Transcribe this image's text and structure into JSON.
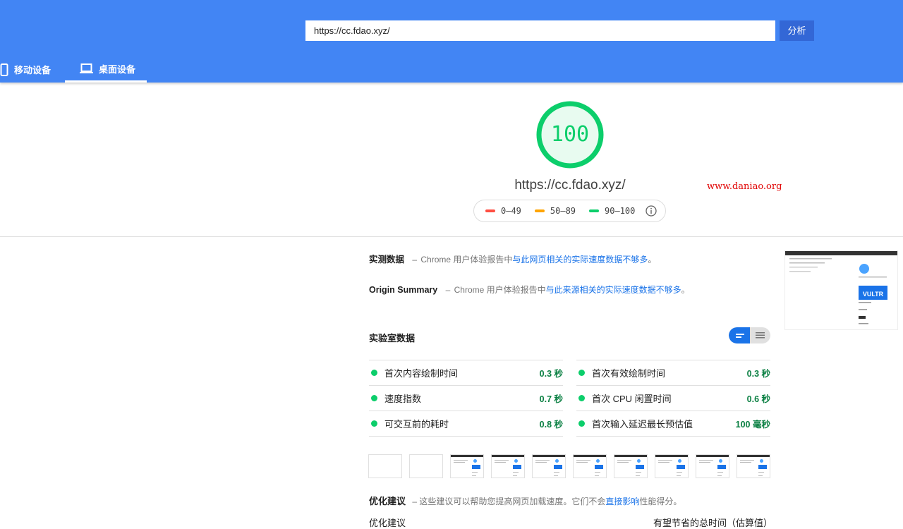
{
  "header": {
    "url_value": "https://cc.fdao.xyz/",
    "analyze_label": "分析",
    "tabs": [
      {
        "label": "移动设备",
        "icon": "phone-icon",
        "active": false
      },
      {
        "label": "桌面设备",
        "icon": "laptop-icon",
        "active": true
      }
    ]
  },
  "summary": {
    "score": "100",
    "score_fraction": 1.0,
    "url": "https://cc.fdao.xyz/",
    "watermark": "www.daniao.org",
    "legend": [
      {
        "range": "0–49",
        "color": "#ff4e42"
      },
      {
        "range": "50–89",
        "color": "#ffa400"
      },
      {
        "range": "90–100",
        "color": "#0cce6b"
      }
    ]
  },
  "field_data": {
    "title": "实测数据",
    "dash": "–",
    "prefix": "Chrome 用户体验报告中",
    "link": "与此网页相关的实际速度数据不够多",
    "suffix": "。"
  },
  "origin_summary": {
    "title": "Origin Summary",
    "dash": "–",
    "prefix": "Chrome 用户体验报告中",
    "link": "与此来源相关的实际速度数据不够多",
    "suffix": "。"
  },
  "lab_data": {
    "title": "实验室数据",
    "metrics": [
      {
        "label": "首次内容绘制时间",
        "value": "0.3 秒"
      },
      {
        "label": "首次有效绘制时间",
        "value": "0.3 秒"
      },
      {
        "label": "速度指数",
        "value": "0.7 秒"
      },
      {
        "label": "首次 CPU 闲置时间",
        "value": "0.6 秒"
      },
      {
        "label": "可交互前的耗时",
        "value": "0.8 秒"
      },
      {
        "label": "首次输入延迟最长预估值",
        "value": "100 毫秒"
      }
    ]
  },
  "thumbnail": {
    "brand_text": "VULTR"
  },
  "opportunities": {
    "title": "优化建议",
    "dash": "–",
    "prefix": "这些建议可以帮助您提高网页加载速度。它们不会",
    "link": "直接影响",
    "suffix": "性能得分。",
    "col_left": "优化建议",
    "col_right": "有望节省的总时间（估算值）"
  },
  "colors": {
    "header_bg": "#4285f4",
    "button_bg": "#3367d6",
    "pass_green": "#0cce6b",
    "link_blue": "#1a73e8"
  }
}
